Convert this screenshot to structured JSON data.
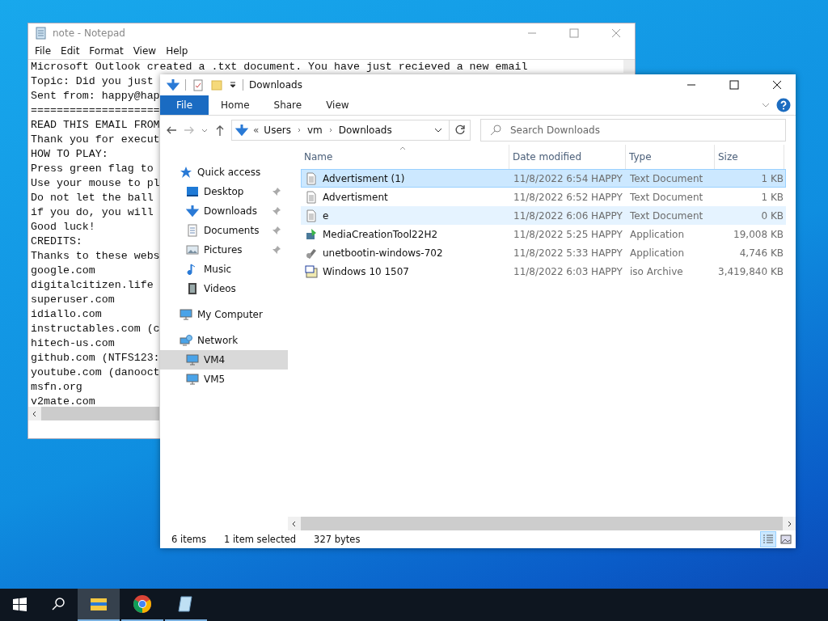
{
  "notepad": {
    "title": "note - Notepad",
    "menu": [
      "File",
      "Edit",
      "Format",
      "View",
      "Help"
    ],
    "lines": [
      "Microsoft Outlook created a .txt document. You have just recieved a new email",
      "Topic: Did you just",
      "Sent from: happy@hap",
      "====================",
      "READ THIS EMAIL FROM",
      "Thank you for execut",
      "HOW TO PLAY:",
      "Press green flag to",
      "Use your mouse to pl",
      "Do not let the ball",
      "if you do, you will",
      "Good luck!",
      "CREDITS:",
      "Thanks to these webs",
      "google.com",
      "digitalcitizen.life",
      "superuser.com",
      "idiallo.com",
      "instructables.com (c",
      "hitech-us.com",
      "github.com (NTFS123:",
      "youtube.com (danooct",
      "msfn.org",
      "v2mate.com"
    ]
  },
  "explorer": {
    "title": "Downloads",
    "ribbon_tabs": [
      {
        "label": "File",
        "selected": true
      },
      {
        "label": "Home",
        "selected": false
      },
      {
        "label": "Share",
        "selected": false
      },
      {
        "label": "View",
        "selected": false
      }
    ],
    "address": {
      "prefix": "«",
      "crumbs": [
        "Users",
        "vm",
        "Downloads"
      ]
    },
    "search": {
      "placeholder": "Search Downloads"
    },
    "nav": [
      {
        "label": "Quick access",
        "kind": "star",
        "selected": false,
        "children": [
          {
            "label": "Desktop",
            "kind": "desktop",
            "pinned": true,
            "selected": false
          },
          {
            "label": "Downloads",
            "kind": "download",
            "pinned": true,
            "selected": false
          },
          {
            "label": "Documents",
            "kind": "document",
            "pinned": true,
            "selected": false
          },
          {
            "label": "Pictures",
            "kind": "pictures",
            "pinned": true,
            "selected": false
          },
          {
            "label": "Music",
            "kind": "music",
            "pinned": false,
            "selected": false
          },
          {
            "label": "Videos",
            "kind": "videos",
            "pinned": false,
            "selected": false
          }
        ]
      },
      {
        "label": "My Computer",
        "kind": "computer",
        "selected": false
      },
      {
        "label": "Network",
        "kind": "network",
        "selected": false,
        "children": [
          {
            "label": "VM4",
            "kind": "computer",
            "pinned": false,
            "selected": true
          },
          {
            "label": "VM5",
            "kind": "computer",
            "pinned": false,
            "selected": false
          }
        ]
      }
    ],
    "columns": [
      "Name",
      "Date modified",
      "Type",
      "Size"
    ],
    "rows": [
      {
        "name": "Advertisment (1)",
        "kind": "text",
        "date": "11/8/2022 6:54 HAPPY",
        "type": "Text Document",
        "size": "1 KB",
        "selected": true,
        "hovered": false
      },
      {
        "name": "Advertisment",
        "kind": "text",
        "date": "11/8/2022 6:52 HAPPY",
        "type": "Text Document",
        "size": "1 KB",
        "selected": false,
        "hovered": false
      },
      {
        "name": "e",
        "kind": "text",
        "date": "11/8/2022 6:06 HAPPY",
        "type": "Text Document",
        "size": "0 KB",
        "selected": false,
        "hovered": true
      },
      {
        "name": "MediaCreationTool22H2",
        "kind": "setup",
        "date": "11/8/2022 5:25 HAPPY",
        "type": "Application",
        "size": "19,008 KB",
        "selected": false,
        "hovered": false
      },
      {
        "name": "unetbootin-windows-702",
        "kind": "app",
        "date": "11/8/2022 5:33 HAPPY",
        "type": "Application",
        "size": "4,746 KB",
        "selected": false,
        "hovered": false
      },
      {
        "name": "Windows 10 1507",
        "kind": "iso",
        "date": "11/8/2022 6:03 HAPPY",
        "type": "iso Archive",
        "size": "3,419,840 KB",
        "selected": false,
        "hovered": false
      }
    ],
    "status": {
      "count": "6 items",
      "selection": "1 item selected",
      "bytes": "327 bytes"
    },
    "views": [
      {
        "kind": "details",
        "selected": true
      },
      {
        "kind": "large",
        "selected": false
      }
    ]
  },
  "taskbar": [
    {
      "kind": "explorer",
      "active": true
    },
    {
      "kind": "chrome",
      "active": false
    },
    {
      "kind": "notepad",
      "active": false
    }
  ]
}
